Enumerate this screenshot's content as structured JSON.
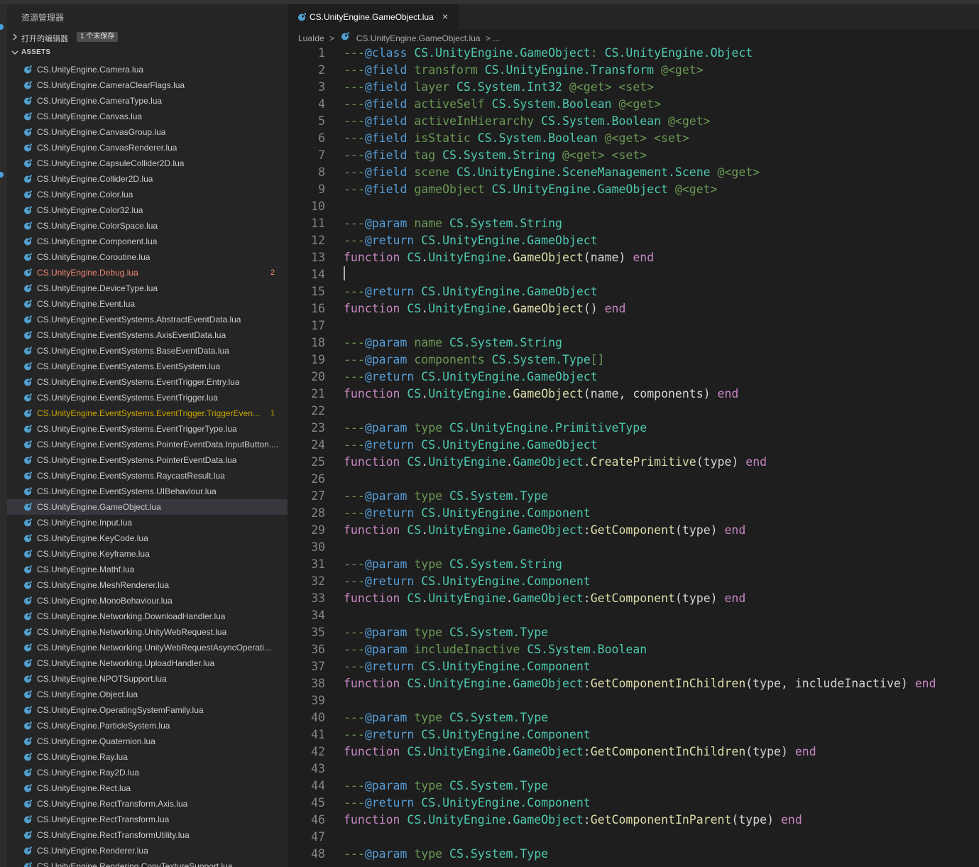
{
  "colors": {
    "comment": "#6a9955",
    "tag": "#569cd6",
    "type": "#4ec9b0",
    "keyword": "#c586c0",
    "function": "#dcdcaa",
    "text": "#d4d4d4",
    "error": "#f48771",
    "warning": "#cca700",
    "default_file": "#cccccc",
    "lua_icon": "#51a0cf"
  },
  "sidebar": {
    "title": "资源管理器",
    "open_editors": {
      "label": "打开的编辑器",
      "badge": "1 个未保存",
      "collapsed_icon": "chevron-right-icon"
    },
    "assets": {
      "label": "ASSETS",
      "expanded_icon": "chevron-down-icon"
    },
    "file_icon": "lua-file-icon",
    "files": [
      {
        "name": "CS.UnityEngine.Camera.lua"
      },
      {
        "name": "CS.UnityEngine.CameraClearFlags.lua"
      },
      {
        "name": "CS.UnityEngine.CameraType.lua"
      },
      {
        "name": "CS.UnityEngine.Canvas.lua"
      },
      {
        "name": "CS.UnityEngine.CanvasGroup.lua"
      },
      {
        "name": "CS.UnityEngine.CanvasRenderer.lua"
      },
      {
        "name": "CS.UnityEngine.CapsuleCollider2D.lua"
      },
      {
        "name": "CS.UnityEngine.Collider2D.lua"
      },
      {
        "name": "CS.UnityEngine.Color.lua"
      },
      {
        "name": "CS.UnityEngine.Color32.lua"
      },
      {
        "name": "CS.UnityEngine.ColorSpace.lua"
      },
      {
        "name": "CS.UnityEngine.Component.lua"
      },
      {
        "name": "CS.UnityEngine.Coroutine.lua"
      },
      {
        "name": "CS.UnityEngine.Debug.lua",
        "state": "error",
        "badge": "2"
      },
      {
        "name": "CS.UnityEngine.DeviceType.lua"
      },
      {
        "name": "CS.UnityEngine.Event.lua"
      },
      {
        "name": "CS.UnityEngine.EventSystems.AbstractEventData.lua"
      },
      {
        "name": "CS.UnityEngine.EventSystems.AxisEventData.lua"
      },
      {
        "name": "CS.UnityEngine.EventSystems.BaseEventData.lua"
      },
      {
        "name": "CS.UnityEngine.EventSystems.EventSystem.lua"
      },
      {
        "name": "CS.UnityEngine.EventSystems.EventTrigger.Entry.lua"
      },
      {
        "name": "CS.UnityEngine.EventSystems.EventTrigger.lua"
      },
      {
        "name": "CS.UnityEngine.EventSystems.EventTrigger.TriggerEven...",
        "state": "warning",
        "badge": "1"
      },
      {
        "name": "CS.UnityEngine.EventSystems.EventTriggerType.lua"
      },
      {
        "name": "CS.UnityEngine.EventSystems.PointerEventData.InputButton...."
      },
      {
        "name": "CS.UnityEngine.EventSystems.PointerEventData.lua"
      },
      {
        "name": "CS.UnityEngine.EventSystems.RaycastResult.lua"
      },
      {
        "name": "CS.UnityEngine.EventSystems.UIBehaviour.lua"
      },
      {
        "name": "CS.UnityEngine.GameObject.lua",
        "selected": true
      },
      {
        "name": "CS.UnityEngine.Input.lua"
      },
      {
        "name": "CS.UnityEngine.KeyCode.lua"
      },
      {
        "name": "CS.UnityEngine.Keyframe.lua"
      },
      {
        "name": "CS.UnityEngine.Mathf.lua"
      },
      {
        "name": "CS.UnityEngine.MeshRenderer.lua"
      },
      {
        "name": "CS.UnityEngine.MonoBehaviour.lua"
      },
      {
        "name": "CS.UnityEngine.Networking.DownloadHandler.lua"
      },
      {
        "name": "CS.UnityEngine.Networking.UnityWebRequest.lua"
      },
      {
        "name": "CS.UnityEngine.Networking.UnityWebRequestAsyncOperati..."
      },
      {
        "name": "CS.UnityEngine.Networking.UploadHandler.lua"
      },
      {
        "name": "CS.UnityEngine.NPOTSupport.lua"
      },
      {
        "name": "CS.UnityEngine.Object.lua"
      },
      {
        "name": "CS.UnityEngine.OperatingSystemFamily.lua"
      },
      {
        "name": "CS.UnityEngine.ParticleSystem.lua"
      },
      {
        "name": "CS.UnityEngine.Quaternion.lua"
      },
      {
        "name": "CS.UnityEngine.Ray.lua"
      },
      {
        "name": "CS.UnityEngine.Ray2D.lua"
      },
      {
        "name": "CS.UnityEngine.Rect.lua"
      },
      {
        "name": "CS.UnityEngine.RectTransform.Axis.lua"
      },
      {
        "name": "CS.UnityEngine.RectTransform.lua"
      },
      {
        "name": "CS.UnityEngine.RectTransformUtility.lua"
      },
      {
        "name": "CS.UnityEngine.Renderer.lua"
      },
      {
        "name": "CS.UnityEngine.Rendering.CopyTextureSupport.lua"
      }
    ]
  },
  "editor": {
    "tab": {
      "label": "CS.UnityEngine.GameObject.lua",
      "close": "×",
      "icon": "lua-file-icon"
    },
    "breadcrumb": {
      "root": "LuaIde",
      "separator": ">",
      "file": "CS.UnityEngine.GameObject.lua",
      "trail": "> ..."
    },
    "cursor_line": 14,
    "lines": [
      [
        [
          "c",
          "---"
        ],
        [
          "t",
          "@class"
        ],
        [
          "x",
          " "
        ],
        [
          "y",
          "CS.UnityEngine.GameObject"
        ],
        [
          "c",
          ": "
        ],
        [
          "y",
          "CS.UnityEngine.Object"
        ]
      ],
      [
        [
          "c",
          "---"
        ],
        [
          "t",
          "@field"
        ],
        [
          "c",
          " transform "
        ],
        [
          "y",
          "CS.UnityEngine.Transform"
        ],
        [
          "c",
          " @<get>"
        ]
      ],
      [
        [
          "c",
          "---"
        ],
        [
          "t",
          "@field"
        ],
        [
          "c",
          " layer "
        ],
        [
          "y",
          "CS.System.Int32"
        ],
        [
          "c",
          " @<get> <set>"
        ]
      ],
      [
        [
          "c",
          "---"
        ],
        [
          "t",
          "@field"
        ],
        [
          "c",
          " activeSelf "
        ],
        [
          "y",
          "CS.System.Boolean"
        ],
        [
          "c",
          " @<get>"
        ]
      ],
      [
        [
          "c",
          "---"
        ],
        [
          "t",
          "@field"
        ],
        [
          "c",
          " activeInHierarchy "
        ],
        [
          "y",
          "CS.System.Boolean"
        ],
        [
          "c",
          " @<get>"
        ]
      ],
      [
        [
          "c",
          "---"
        ],
        [
          "t",
          "@field"
        ],
        [
          "c",
          " isStatic "
        ],
        [
          "y",
          "CS.System.Boolean"
        ],
        [
          "c",
          " @<get> <set>"
        ]
      ],
      [
        [
          "c",
          "---"
        ],
        [
          "t",
          "@field"
        ],
        [
          "c",
          " tag "
        ],
        [
          "y",
          "CS.System.String"
        ],
        [
          "c",
          " @<get> <set>"
        ]
      ],
      [
        [
          "c",
          "---"
        ],
        [
          "t",
          "@field"
        ],
        [
          "c",
          " scene "
        ],
        [
          "y",
          "CS.UnityEngine.SceneManagement.Scene"
        ],
        [
          "c",
          " @<get>"
        ]
      ],
      [
        [
          "c",
          "---"
        ],
        [
          "t",
          "@field"
        ],
        [
          "c",
          " gameObject "
        ],
        [
          "y",
          "CS.UnityEngine.GameObject"
        ],
        [
          "c",
          " @<get>"
        ]
      ],
      [],
      [
        [
          "c",
          "---"
        ],
        [
          "t",
          "@param"
        ],
        [
          "c",
          " name "
        ],
        [
          "y",
          "CS.System.String"
        ]
      ],
      [
        [
          "c",
          "---"
        ],
        [
          "t",
          "@return"
        ],
        [
          "c",
          " "
        ],
        [
          "y",
          "CS.UnityEngine.GameObject"
        ]
      ],
      [
        [
          "k",
          "function"
        ],
        [
          "x",
          " "
        ],
        [
          "y",
          "CS"
        ],
        [
          "x",
          "."
        ],
        [
          "y",
          "UnityEngine"
        ],
        [
          "x",
          "."
        ],
        [
          "f",
          "GameObject"
        ],
        [
          "x",
          "(name) "
        ],
        [
          "k",
          "end"
        ]
      ],
      [],
      [
        [
          "c",
          "---"
        ],
        [
          "t",
          "@return"
        ],
        [
          "c",
          " "
        ],
        [
          "y",
          "CS.UnityEngine.GameObject"
        ]
      ],
      [
        [
          "k",
          "function"
        ],
        [
          "x",
          " "
        ],
        [
          "y",
          "CS"
        ],
        [
          "x",
          "."
        ],
        [
          "y",
          "UnityEngine"
        ],
        [
          "x",
          "."
        ],
        [
          "f",
          "GameObject"
        ],
        [
          "x",
          "() "
        ],
        [
          "k",
          "end"
        ]
      ],
      [],
      [
        [
          "c",
          "---"
        ],
        [
          "t",
          "@param"
        ],
        [
          "c",
          " name "
        ],
        [
          "y",
          "CS.System.String"
        ]
      ],
      [
        [
          "c",
          "---"
        ],
        [
          "t",
          "@param"
        ],
        [
          "c",
          " components "
        ],
        [
          "y",
          "CS.System.Type"
        ],
        [
          "c",
          "[]"
        ]
      ],
      [
        [
          "c",
          "---"
        ],
        [
          "t",
          "@return"
        ],
        [
          "c",
          " "
        ],
        [
          "y",
          "CS.UnityEngine.GameObject"
        ]
      ],
      [
        [
          "k",
          "function"
        ],
        [
          "x",
          " "
        ],
        [
          "y",
          "CS"
        ],
        [
          "x",
          "."
        ],
        [
          "y",
          "UnityEngine"
        ],
        [
          "x",
          "."
        ],
        [
          "f",
          "GameObject"
        ],
        [
          "x",
          "(name, components) "
        ],
        [
          "k",
          "end"
        ]
      ],
      [],
      [
        [
          "c",
          "---"
        ],
        [
          "t",
          "@param"
        ],
        [
          "c",
          " type "
        ],
        [
          "y",
          "CS.UnityEngine.PrimitiveType"
        ]
      ],
      [
        [
          "c",
          "---"
        ],
        [
          "t",
          "@return"
        ],
        [
          "c",
          " "
        ],
        [
          "y",
          "CS.UnityEngine.GameObject"
        ]
      ],
      [
        [
          "k",
          "function"
        ],
        [
          "x",
          " "
        ],
        [
          "y",
          "CS"
        ],
        [
          "x",
          "."
        ],
        [
          "y",
          "UnityEngine"
        ],
        [
          "x",
          "."
        ],
        [
          "y",
          "GameObject"
        ],
        [
          "x",
          "."
        ],
        [
          "f",
          "CreatePrimitive"
        ],
        [
          "x",
          "(type) "
        ],
        [
          "k",
          "end"
        ]
      ],
      [],
      [
        [
          "c",
          "---"
        ],
        [
          "t",
          "@param"
        ],
        [
          "c",
          " type "
        ],
        [
          "y",
          "CS.System.Type"
        ]
      ],
      [
        [
          "c",
          "---"
        ],
        [
          "t",
          "@return"
        ],
        [
          "c",
          " "
        ],
        [
          "y",
          "CS.UnityEngine.Component"
        ]
      ],
      [
        [
          "k",
          "function"
        ],
        [
          "x",
          " "
        ],
        [
          "y",
          "CS"
        ],
        [
          "x",
          "."
        ],
        [
          "y",
          "UnityEngine"
        ],
        [
          "x",
          "."
        ],
        [
          "y",
          "GameObject"
        ],
        [
          "x",
          ":"
        ],
        [
          "f",
          "GetComponent"
        ],
        [
          "x",
          "(type) "
        ],
        [
          "k",
          "end"
        ]
      ],
      [],
      [
        [
          "c",
          "---"
        ],
        [
          "t",
          "@param"
        ],
        [
          "c",
          " type "
        ],
        [
          "y",
          "CS.System.String"
        ]
      ],
      [
        [
          "c",
          "---"
        ],
        [
          "t",
          "@return"
        ],
        [
          "c",
          " "
        ],
        [
          "y",
          "CS.UnityEngine.Component"
        ]
      ],
      [
        [
          "k",
          "function"
        ],
        [
          "x",
          " "
        ],
        [
          "y",
          "CS"
        ],
        [
          "x",
          "."
        ],
        [
          "y",
          "UnityEngine"
        ],
        [
          "x",
          "."
        ],
        [
          "y",
          "GameObject"
        ],
        [
          "x",
          ":"
        ],
        [
          "f",
          "GetComponent"
        ],
        [
          "x",
          "(type) "
        ],
        [
          "k",
          "end"
        ]
      ],
      [],
      [
        [
          "c",
          "---"
        ],
        [
          "t",
          "@param"
        ],
        [
          "c",
          " type "
        ],
        [
          "y",
          "CS.System.Type"
        ]
      ],
      [
        [
          "c",
          "---"
        ],
        [
          "t",
          "@param"
        ],
        [
          "c",
          " includeInactive "
        ],
        [
          "y",
          "CS.System.Boolean"
        ]
      ],
      [
        [
          "c",
          "---"
        ],
        [
          "t",
          "@return"
        ],
        [
          "c",
          " "
        ],
        [
          "y",
          "CS.UnityEngine.Component"
        ]
      ],
      [
        [
          "k",
          "function"
        ],
        [
          "x",
          " "
        ],
        [
          "y",
          "CS"
        ],
        [
          "x",
          "."
        ],
        [
          "y",
          "UnityEngine"
        ],
        [
          "x",
          "."
        ],
        [
          "y",
          "GameObject"
        ],
        [
          "x",
          ":"
        ],
        [
          "f",
          "GetComponentInChildren"
        ],
        [
          "x",
          "(type, includeInactive) "
        ],
        [
          "k",
          "end"
        ]
      ],
      [],
      [
        [
          "c",
          "---"
        ],
        [
          "t",
          "@param"
        ],
        [
          "c",
          " type "
        ],
        [
          "y",
          "CS.System.Type"
        ]
      ],
      [
        [
          "c",
          "---"
        ],
        [
          "t",
          "@return"
        ],
        [
          "c",
          " "
        ],
        [
          "y",
          "CS.UnityEngine.Component"
        ]
      ],
      [
        [
          "k",
          "function"
        ],
        [
          "x",
          " "
        ],
        [
          "y",
          "CS"
        ],
        [
          "x",
          "."
        ],
        [
          "y",
          "UnityEngine"
        ],
        [
          "x",
          "."
        ],
        [
          "y",
          "GameObject"
        ],
        [
          "x",
          ":"
        ],
        [
          "f",
          "GetComponentInChildren"
        ],
        [
          "x",
          "(type) "
        ],
        [
          "k",
          "end"
        ]
      ],
      [],
      [
        [
          "c",
          "---"
        ],
        [
          "t",
          "@param"
        ],
        [
          "c",
          " type "
        ],
        [
          "y",
          "CS.System.Type"
        ]
      ],
      [
        [
          "c",
          "---"
        ],
        [
          "t",
          "@return"
        ],
        [
          "c",
          " "
        ],
        [
          "y",
          "CS.UnityEngine.Component"
        ]
      ],
      [
        [
          "k",
          "function"
        ],
        [
          "x",
          " "
        ],
        [
          "y",
          "CS"
        ],
        [
          "x",
          "."
        ],
        [
          "y",
          "UnityEngine"
        ],
        [
          "x",
          "."
        ],
        [
          "y",
          "GameObject"
        ],
        [
          "x",
          ":"
        ],
        [
          "f",
          "GetComponentInParent"
        ],
        [
          "x",
          "(type) "
        ],
        [
          "k",
          "end"
        ]
      ],
      [],
      [
        [
          "c",
          "---"
        ],
        [
          "t",
          "@param"
        ],
        [
          "c",
          " type "
        ],
        [
          "y",
          "CS.System.Type"
        ]
      ]
    ]
  }
}
